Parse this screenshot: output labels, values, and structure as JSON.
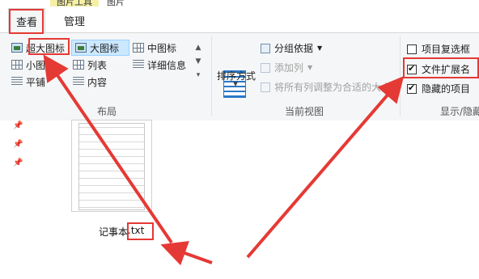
{
  "tabs": {
    "view": "查看",
    "manage": "管理",
    "context_title": "图片工具",
    "extra": "图片"
  },
  "layout_group": {
    "label": "布局",
    "items": [
      {
        "label": "超大图标",
        "icon": "extra-large-icons-icon"
      },
      {
        "label": "大图标",
        "icon": "large-icons-icon",
        "selected": true
      },
      {
        "label": "中图标",
        "icon": "medium-icons-icon"
      },
      {
        "label": "小图标",
        "icon": "small-icons-icon"
      },
      {
        "label": "列表",
        "icon": "list-icon"
      },
      {
        "label": "详细信息",
        "icon": "details-icon"
      },
      {
        "label": "平铺",
        "icon": "tiles-icon"
      },
      {
        "label": "内容",
        "icon": "content-icon"
      }
    ]
  },
  "current_view_group": {
    "label": "当前视图",
    "sort_label": "排序方式",
    "group_by": "分组依据",
    "add_column": "添加列",
    "size_all_columns": "将所有列调整为合适的大小"
  },
  "show_hide_group": {
    "label": "显示/隐藏",
    "item_checkboxes": {
      "label": "项目复选框",
      "checked": false
    },
    "file_extensions": {
      "label": "文件扩展名",
      "checked": true
    },
    "hidden_items": {
      "label": "隐藏的项目",
      "checked": true
    }
  },
  "file": {
    "name_base": "记事本",
    "extension": ".txt"
  },
  "colors": {
    "annotation_red": "#e53935",
    "selected_bg": "#cce8ff",
    "context_tab": "#f5f0a6"
  }
}
